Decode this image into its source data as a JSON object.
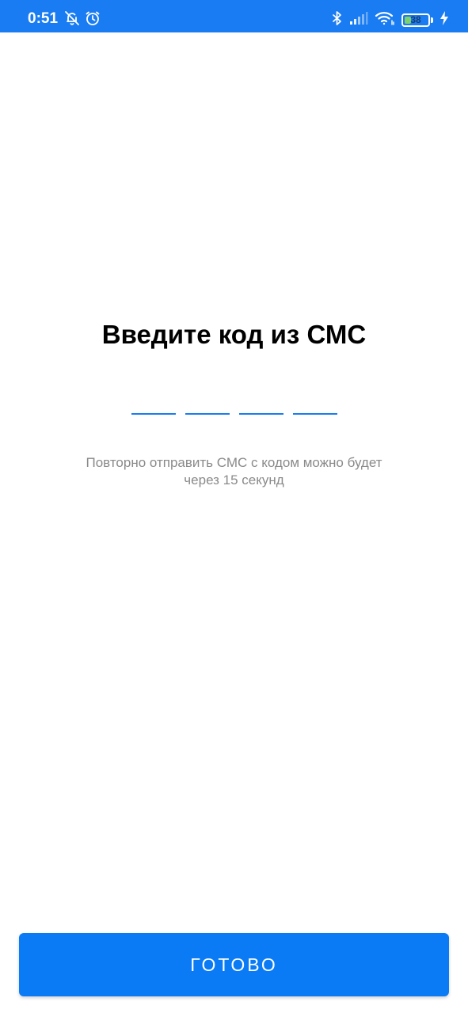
{
  "status_bar": {
    "time": "0:51",
    "battery_level": "38",
    "colors": {
      "background": "#1a7cf2",
      "battery_fill": "#7dd36b"
    },
    "icons": [
      "bell-off-icon",
      "alarm-icon",
      "bluetooth-icon",
      "signal-icon",
      "wifi-icon",
      "battery-icon",
      "charging-icon"
    ]
  },
  "main": {
    "title": "Введите код из СМС",
    "code_length": 4,
    "resend_line1": "Повторно отправить СМС с кодом можно будет",
    "resend_line2": "через 15 секунд"
  },
  "footer": {
    "done_label": "ГОТОВО"
  },
  "theme": {
    "accent": "#0a7bf5",
    "hint_text": "#8a8a8a"
  }
}
